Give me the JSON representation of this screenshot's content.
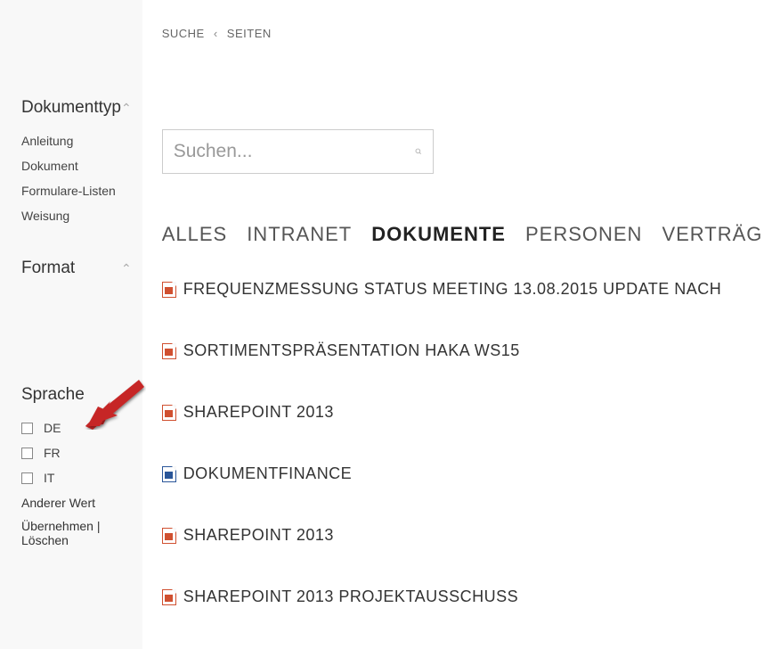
{
  "breadcrumb": {
    "item1": "SUCHE",
    "sep": "‹",
    "item2": "SEITEN"
  },
  "search": {
    "placeholder": "Suchen..."
  },
  "tabs": [
    {
      "label": "ALLES",
      "active": false
    },
    {
      "label": "INTRANET",
      "active": false
    },
    {
      "label": "DOKUMENTE",
      "active": true
    },
    {
      "label": "PERSONEN",
      "active": false
    },
    {
      "label": "VERTRÄGE",
      "active": false
    }
  ],
  "facets": {
    "dokumenttyp": {
      "title": "Dokumenttyp",
      "items": [
        "Anleitung",
        "Dokument",
        "Formulare-Listen",
        "Weisung"
      ]
    },
    "format": {
      "title": "Format"
    },
    "sprache": {
      "title": "Sprache",
      "options": [
        "DE",
        "FR",
        "IT"
      ],
      "other": "Anderer Wert",
      "apply": "Übernehmen",
      "sep": " | ",
      "clear": "Löschen"
    }
  },
  "results": [
    {
      "icon": "ppt",
      "title": "FREQUENZMESSUNG STATUS MEETING 13.08.2015 UPDATE NACH"
    },
    {
      "icon": "ppt",
      "title": "SORTIMENTSPRÄSENTATION HAKA WS15"
    },
    {
      "icon": "ppt",
      "title": "SHAREPOINT 2013"
    },
    {
      "icon": "doc",
      "title": "DOKUMENTFINANCE"
    },
    {
      "icon": "ppt",
      "title": "SHAREPOINT 2013"
    },
    {
      "icon": "ppt",
      "title": "SHAREPOINT 2013 PROJEKTAUSSCHUSS"
    }
  ]
}
